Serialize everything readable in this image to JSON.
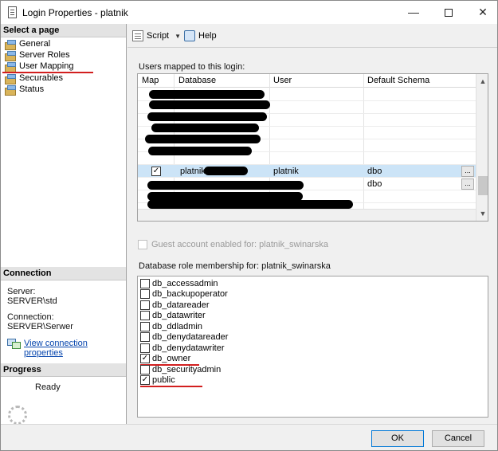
{
  "window": {
    "title": "Login Properties - platnik",
    "minimize_glyph": "—",
    "close_glyph": "✕"
  },
  "left_pane": {
    "select_page_header": "Select a page",
    "pages": [
      "General",
      "Server Roles",
      "User Mapping",
      "Securables",
      "Status"
    ],
    "selected_page": "User Mapping",
    "connection_header": "Connection",
    "server_label": "Server:",
    "server_value": "SERVER\\std",
    "connection_label": "Connection:",
    "connection_value": "SERVER\\Serwer",
    "view_connection_link": "View connection properties",
    "progress_header": "Progress",
    "progress_status": "Ready"
  },
  "toolbar": {
    "script_label": "Script",
    "help_label": "Help"
  },
  "users_mapped": {
    "label": "Users mapped to this login:",
    "columns": [
      "Map",
      "Database",
      "User",
      "Default Schema"
    ],
    "selected_row": {
      "checked": true,
      "database": "platnik",
      "user": "platnik",
      "schema": "dbo"
    },
    "next_row_schema": "dbo",
    "ellipsis": "..."
  },
  "guest": {
    "label": "Guest account enabled for: platnik_swinarska",
    "checked": false
  },
  "roles": {
    "label": "Database role membership for: platnik_swinarska",
    "items": [
      {
        "name": "db_accessadmin",
        "checked": false
      },
      {
        "name": "db_backupoperator",
        "checked": false
      },
      {
        "name": "db_datareader",
        "checked": false
      },
      {
        "name": "db_datawriter",
        "checked": false
      },
      {
        "name": "db_ddladmin",
        "checked": false
      },
      {
        "name": "db_denydatareader",
        "checked": false
      },
      {
        "name": "db_denydatawriter",
        "checked": false
      },
      {
        "name": "db_owner",
        "checked": true
      },
      {
        "name": "db_securityadmin",
        "checked": false
      },
      {
        "name": "public",
        "checked": true
      }
    ]
  },
  "buttons": {
    "ok": "OK",
    "cancel": "Cancel"
  },
  "icons": {
    "check_glyph": "✓",
    "scroll_up": "▲",
    "scroll_down": "▼",
    "dropdown": "▼"
  },
  "colors": {
    "annotation_red": "#d21f1f",
    "selection_blue": "#cce4f7",
    "link_blue": "#0645ad"
  }
}
